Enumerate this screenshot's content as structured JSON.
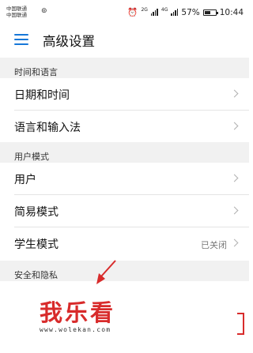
{
  "status_bar": {
    "carrier_1": "中国联通",
    "carrier_2": "中国联通",
    "network_1": "2G",
    "network_2": "4G",
    "battery_percent": "57%",
    "battery_level": 0.57,
    "time": "10:44"
  },
  "header": {
    "title": "高级设置"
  },
  "sections": [
    {
      "title": "时间和语言",
      "items": [
        {
          "label": "日期和时间"
        },
        {
          "label": "语言和输入法"
        }
      ]
    },
    {
      "title": "用户模式",
      "items": [
        {
          "label": "用户"
        },
        {
          "label": "简易模式"
        },
        {
          "label": "学生模式",
          "value": "已关闭"
        }
      ]
    },
    {
      "title": "安全和隐私",
      "items": []
    }
  ],
  "watermark": {
    "logo_text": "我乐看",
    "url": "www.wolekan.com",
    "color": "#d82b2b"
  },
  "colors": {
    "accent": "#1677d8",
    "section_bg": "#f1f1f1"
  }
}
